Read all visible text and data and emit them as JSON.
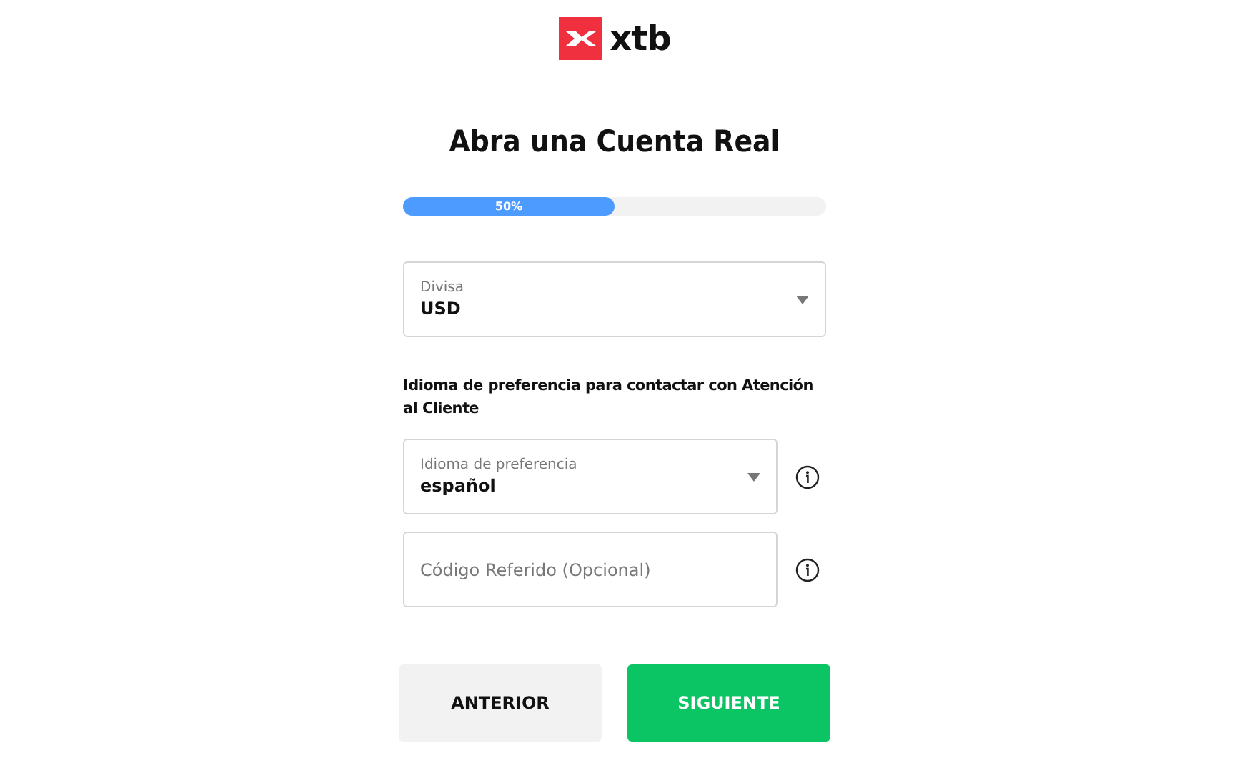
{
  "logo": {
    "text": "xtb"
  },
  "title": "Abra una Cuenta Real",
  "progress": {
    "level": 0.5,
    "reading": "50%"
  },
  "currency": {
    "kind": "select",
    "label": "Divisa",
    "value": "USD",
    "info": false
  },
  "section_heading": "Idioma de preferencia para contactar con Atención al Cliente",
  "fields": [
    {
      "kind": "select",
      "label": "Idioma de preferencia",
      "value": "español",
      "info": true
    },
    {
      "kind": "input",
      "placeholder": "Código Referido (Opcional)",
      "info": true
    }
  ],
  "buttons": [
    {
      "label": "ANTERIOR",
      "kind": "secondary"
    },
    {
      "label": "SIGUIENTE",
      "kind": "primary"
    }
  ]
}
